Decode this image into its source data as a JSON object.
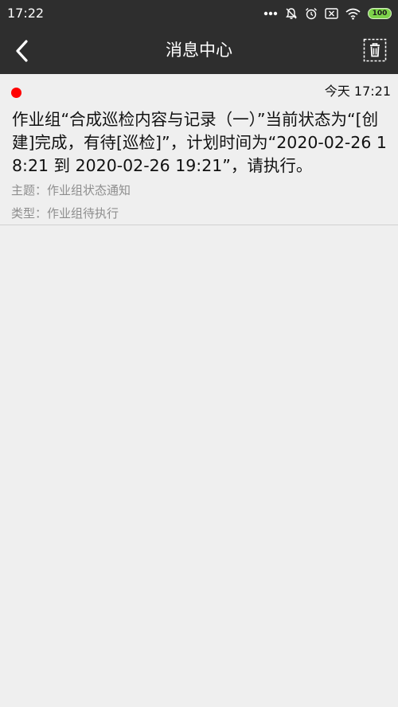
{
  "status_bar": {
    "time": "17:22",
    "battery": "100",
    "icons": [
      "more-dots-icon",
      "mute-bell-icon",
      "alarm-icon",
      "close-box-icon",
      "wifi-icon",
      "battery-icon"
    ]
  },
  "header": {
    "title": "消息中心",
    "back_icon": "chevron-left-icon",
    "delete_icon": "trash-icon"
  },
  "messages": [
    {
      "unread": true,
      "time": "今天 17:21",
      "body": "作业组“合成巡检内容与记录（一）”当前状态为“[创建]完成，有待[巡检]”，计划时间为“2020-02-26 18:21 到 2020-02-26 19:21”，请执行。",
      "subject": "主题：作业组状态通知",
      "type": "类型：作业组待执行"
    }
  ],
  "colors": {
    "bar_background": "#2e2e2e",
    "page_background": "#efefef",
    "unread_dot": "#ff0000",
    "meta_text": "#8e8e8e",
    "battery_fill": "#7ed34b"
  }
}
